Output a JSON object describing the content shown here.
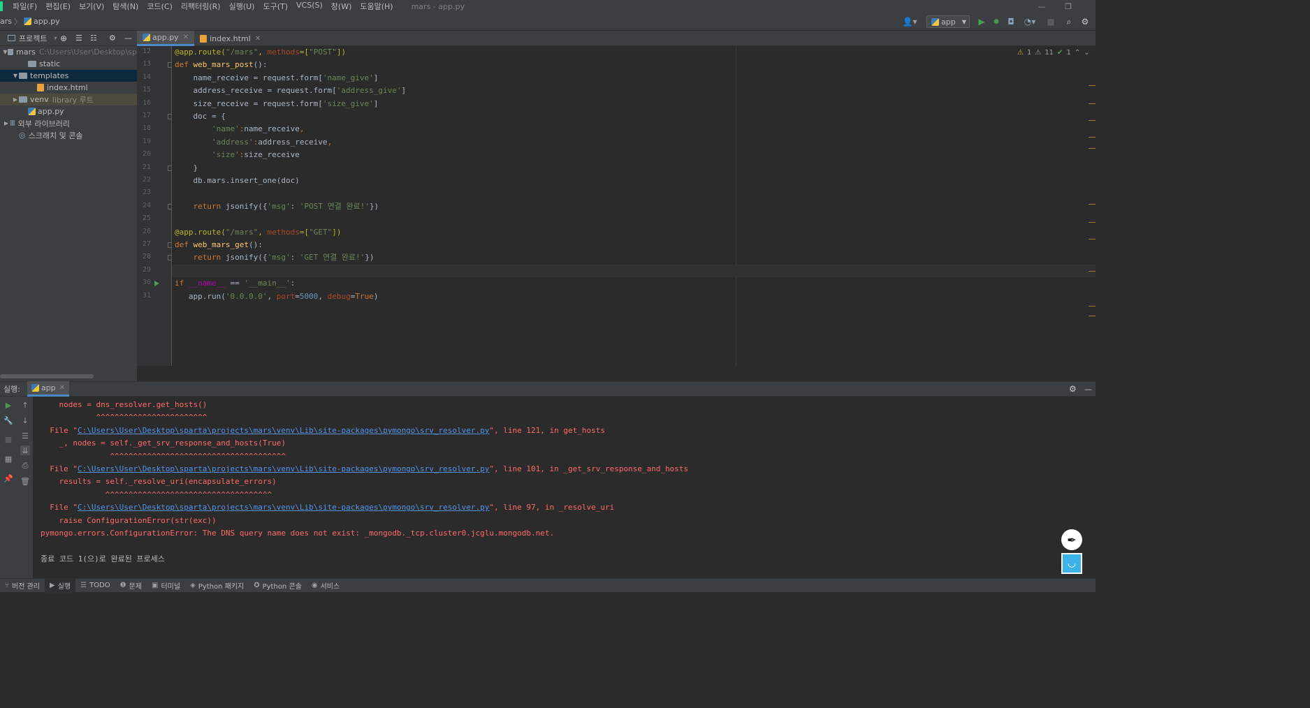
{
  "menu": {
    "items": [
      "파일(F)",
      "편집(E)",
      "보기(V)",
      "탐색(N)",
      "코드(C)",
      "리팩터링(R)",
      "실행(U)",
      "도구(T)",
      "VCS(S)",
      "창(W)",
      "도움말(H)"
    ],
    "window_title": "mars - app.py"
  },
  "breadcrumb": {
    "project": "ars",
    "file": "app.py"
  },
  "run_config": {
    "name": "app"
  },
  "project_panel": {
    "title": "프로젝트",
    "tree": [
      {
        "label": "mars",
        "hint": "C:\\Users\\User\\Desktop\\sp",
        "indent": 0,
        "type": "folder",
        "expanded": true
      },
      {
        "label": "static",
        "indent": 2,
        "type": "folder"
      },
      {
        "label": "templates",
        "indent": 1,
        "type": "folder",
        "expanded": true,
        "selected": true
      },
      {
        "label": "index.html",
        "indent": 3,
        "type": "html"
      },
      {
        "label": "venv",
        "hint": "library 루트",
        "indent": 1,
        "type": "folder",
        "collapsed": true,
        "library": true
      },
      {
        "label": "app.py",
        "indent": 2,
        "type": "py"
      },
      {
        "label": "외부 라이브러리",
        "indent": 0,
        "type": "lib",
        "collapsed": true
      },
      {
        "label": "스크래치 및 콘솔",
        "indent": 1,
        "type": "scratch"
      }
    ]
  },
  "editor": {
    "tabs": [
      {
        "label": "app.py",
        "active": true
      },
      {
        "label": "index.html",
        "active": false
      }
    ],
    "inspections": {
      "warnings": "1",
      "weak_warnings": "11",
      "typos": "1"
    },
    "lines": [
      {
        "n": "12",
        "code": [
          [
            "dec",
            "@app.route("
          ],
          [
            "str",
            "\"/mars\""
          ],
          [
            "dec",
            ", "
          ],
          [
            "prm",
            "methods"
          ],
          [
            "dec",
            "=["
          ],
          [
            "str",
            "\"POST\""
          ],
          [
            "dec",
            "])"
          ]
        ]
      },
      {
        "n": "13",
        "code": [
          [
            "kw",
            "def "
          ],
          [
            "fn",
            "web_mars_post"
          ],
          [
            "",
            "():"
          ]
        ]
      },
      {
        "n": "14",
        "code": [
          [
            "",
            "    name_receive = request.form["
          ],
          [
            "str",
            "'name_give'"
          ],
          [
            "",
            "]"
          ]
        ]
      },
      {
        "n": "15",
        "code": [
          [
            "",
            "    address_receive = request.form["
          ],
          [
            "str",
            "'address_give'"
          ],
          [
            "",
            "]"
          ]
        ]
      },
      {
        "n": "16",
        "code": [
          [
            "",
            "    size_receive = request.form["
          ],
          [
            "str",
            "'size_give'"
          ],
          [
            "",
            "]"
          ]
        ]
      },
      {
        "n": "17",
        "code": [
          [
            "",
            "    doc = {"
          ]
        ]
      },
      {
        "n": "18",
        "code": [
          [
            "",
            "        "
          ],
          [
            "str",
            "'name'"
          ],
          [
            "kw",
            ":"
          ],
          [
            "",
            "name_receive"
          ],
          [
            "kw",
            ","
          ]
        ]
      },
      {
        "n": "19",
        "code": [
          [
            "",
            "        "
          ],
          [
            "str",
            "'address'"
          ],
          [
            "kw",
            ":"
          ],
          [
            "",
            "address_receive"
          ],
          [
            "kw",
            ","
          ]
        ]
      },
      {
        "n": "20",
        "code": [
          [
            "",
            "        "
          ],
          [
            "str",
            "'size'"
          ],
          [
            "kw",
            ":"
          ],
          [
            "",
            "size_receive"
          ]
        ]
      },
      {
        "n": "21",
        "code": [
          [
            "",
            "    }"
          ]
        ]
      },
      {
        "n": "22",
        "code": [
          [
            "",
            "    db.mars.insert_one(doc)"
          ]
        ]
      },
      {
        "n": "23",
        "code": [
          [
            "",
            ""
          ]
        ]
      },
      {
        "n": "24",
        "code": [
          [
            "kw",
            "    return "
          ],
          [
            "",
            "jsonify({"
          ],
          [
            "str",
            "'msg'"
          ],
          [
            "",
            ": "
          ],
          [
            "str",
            "'POST 연결 완료!'"
          ],
          [
            "",
            "})"
          ]
        ]
      },
      {
        "n": "25",
        "code": [
          [
            "",
            ""
          ]
        ]
      },
      {
        "n": "26",
        "code": [
          [
            "dec",
            "@app.route("
          ],
          [
            "str",
            "\"/mars\""
          ],
          [
            "dec",
            ", "
          ],
          [
            "prm",
            "methods"
          ],
          [
            "dec",
            "=["
          ],
          [
            "str",
            "\"GET\""
          ],
          [
            "dec",
            "])"
          ]
        ]
      },
      {
        "n": "27",
        "code": [
          [
            "kw",
            "def "
          ],
          [
            "fn",
            "web_mars_get"
          ],
          [
            "",
            "():"
          ]
        ]
      },
      {
        "n": "28",
        "code": [
          [
            "kw",
            "    return "
          ],
          [
            "",
            "jsonify({"
          ],
          [
            "str",
            "'msg'"
          ],
          [
            "",
            ": "
          ],
          [
            "str",
            "'GET 연결 완료!'"
          ],
          [
            "",
            "})"
          ]
        ]
      },
      {
        "n": "29",
        "code": [
          [
            "",
            ""
          ]
        ]
      },
      {
        "n": "30",
        "code": [
          [
            "kw",
            "if "
          ],
          [
            "dun",
            "__name__"
          ],
          [
            "",
            " == "
          ],
          [
            "str",
            "'__main__'"
          ],
          [
            "",
            ":"
          ]
        ]
      },
      {
        "n": "31",
        "code": [
          [
            "",
            "   app.run("
          ],
          [
            "str",
            "'0.0.0.0'"
          ],
          [
            "",
            ", "
          ],
          [
            "prm",
            "port"
          ],
          [
            "",
            "="
          ],
          [
            "num",
            "5000"
          ],
          [
            "",
            ", "
          ],
          [
            "prm",
            "debug"
          ],
          [
            "",
            "="
          ],
          [
            "kw",
            "True"
          ],
          [
            "",
            ")"
          ]
        ]
      }
    ]
  },
  "run_panel": {
    "label": "실행:",
    "tab": "app",
    "output": [
      {
        "text": "    nodes = dns_resolver.get_hosts()"
      },
      {
        "text": "            ^^^^^^^^^^^^^^^^^^^^^^^^"
      },
      {
        "prefix": "  File \"",
        "link": "C:\\Users\\User\\Desktop\\sparta\\projects\\mars\\venv\\Lib\\site-packages\\pymongo\\srv_resolver.py",
        "suffix": "\", line 121, in get_hosts"
      },
      {
        "text": "    _, nodes = self._get_srv_response_and_hosts(True)"
      },
      {
        "text": "               ^^^^^^^^^^^^^^^^^^^^^^^^^^^^^^^^^^^^^^"
      },
      {
        "prefix": "  File \"",
        "link": "C:\\Users\\User\\Desktop\\sparta\\projects\\mars\\venv\\Lib\\site-packages\\pymongo\\srv_resolver.py",
        "suffix": "\", line 101, in _get_srv_response_and_hosts"
      },
      {
        "text": "    results = self._resolve_uri(encapsulate_errors)"
      },
      {
        "text": "              ^^^^^^^^^^^^^^^^^^^^^^^^^^^^^^^^^^^^"
      },
      {
        "prefix": "  File \"",
        "link": "C:\\Users\\User\\Desktop\\sparta\\projects\\mars\\venv\\Lib\\site-packages\\pymongo\\srv_resolver.py",
        "suffix": "\", line 97, in _resolve_uri"
      },
      {
        "text": "    raise ConfigurationError(str(exc))"
      },
      {
        "text": "pymongo.errors.ConfigurationError: The DNS query name does not exist: _mongodb._tcp.cluster0.jcglu.mongodb.net."
      },
      {
        "text": ""
      },
      {
        "text": "종료 코드 1(으)로 완료된 프로세스",
        "normal": true
      }
    ]
  },
  "status_bar": {
    "items": [
      {
        "label": "버전 관리",
        "icon": "branch-icon"
      },
      {
        "label": "실행",
        "icon": "play-icon",
        "active": true
      },
      {
        "label": "TODO",
        "icon": "list-icon"
      },
      {
        "label": "문제",
        "icon": "info-icon"
      },
      {
        "label": "터미널",
        "icon": "terminal-icon"
      },
      {
        "label": "Python 패키지",
        "icon": "layers-icon"
      },
      {
        "label": "Python 콘솔",
        "icon": "python-icon"
      },
      {
        "label": "서비스",
        "icon": "service-icon"
      }
    ]
  },
  "colors": {
    "accent": "#4a88c7",
    "run_green": "#499c54",
    "error_red": "#ff6b68",
    "link_blue": "#5394ec"
  }
}
